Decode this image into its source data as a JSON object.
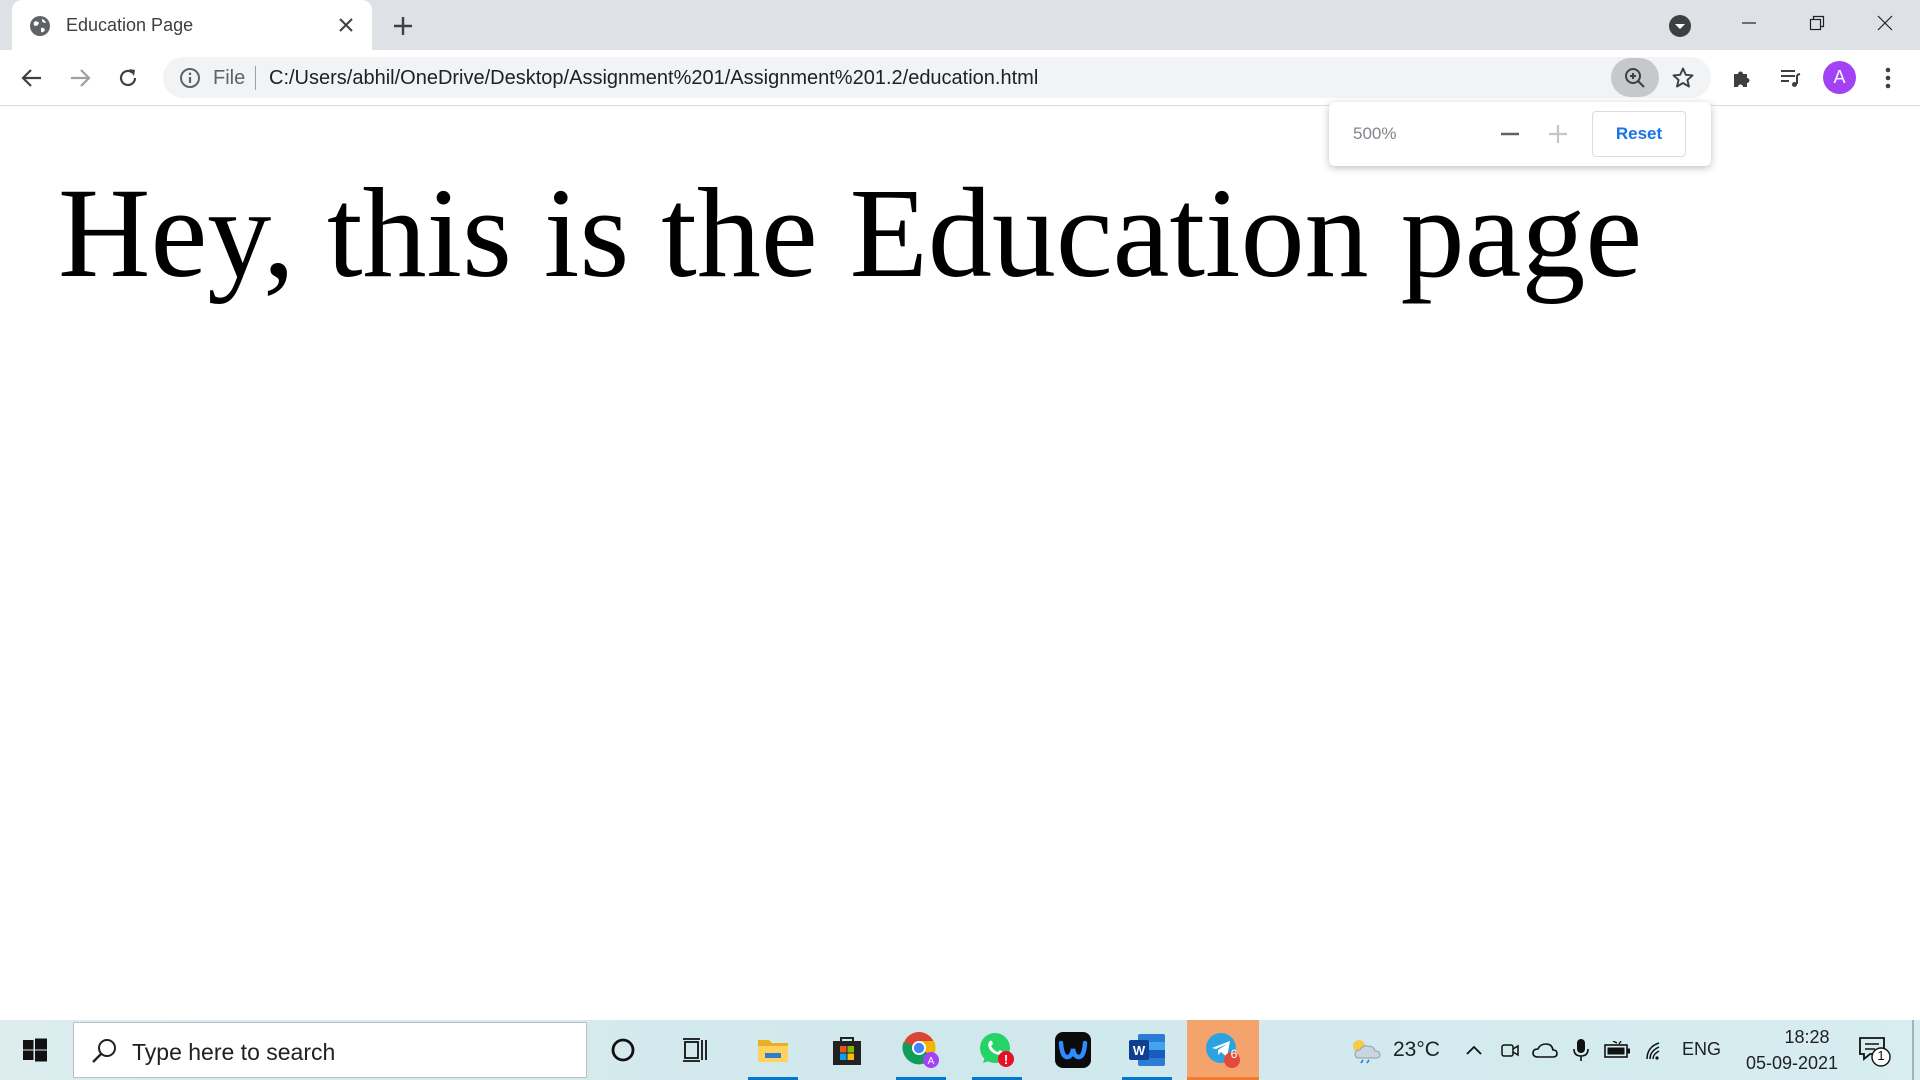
{
  "browser": {
    "tab": {
      "title": "Education Page"
    },
    "address": {
      "scheme": "File",
      "url": "C:/Users/abhil/OneDrive/Desktop/Assignment%201/Assignment%201.2/education.html"
    },
    "profile_initial": "A",
    "avatar_color": "#a142f4"
  },
  "zoom_popup": {
    "level": "500%",
    "reset_label": "Reset"
  },
  "page": {
    "heading": "Hey, this is the Education page"
  },
  "taskbar": {
    "search_placeholder": "Type here to search",
    "apps": [
      "cortana-icon",
      "task-view-icon",
      "file-explorer-icon",
      "microsoft-store-icon",
      "chrome-icon",
      "whatsapp-icon",
      "webex-icon",
      "word-icon",
      "telegram-icon"
    ],
    "telegram_badge": "6",
    "weather": {
      "temperature": "23°C"
    },
    "language": "ENG",
    "clock": {
      "time": "18:28",
      "date": "05-09-2021"
    },
    "notification_count": "1"
  }
}
